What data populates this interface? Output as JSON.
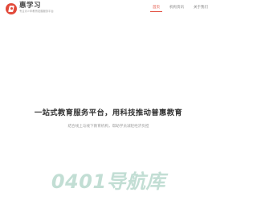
{
  "brand": {
    "name": "惠学习",
    "slogan": "专注青少年教育发展服务平台"
  },
  "nav": {
    "items": [
      {
        "label": "首页",
        "active": true
      },
      {
        "label": "机构资讯",
        "active": false
      },
      {
        "label": "关于我们",
        "active": false
      }
    ]
  },
  "hero": {
    "title": "一站式教育服务平台，用科技推动普惠教育",
    "subtitle": "结合线上与线下教育机构，帮助学员减轻经济负担"
  },
  "watermark": {
    "text": "0401导航库"
  },
  "colors": {
    "accent": "#e24a3b",
    "watermark": "#c2ded4"
  }
}
